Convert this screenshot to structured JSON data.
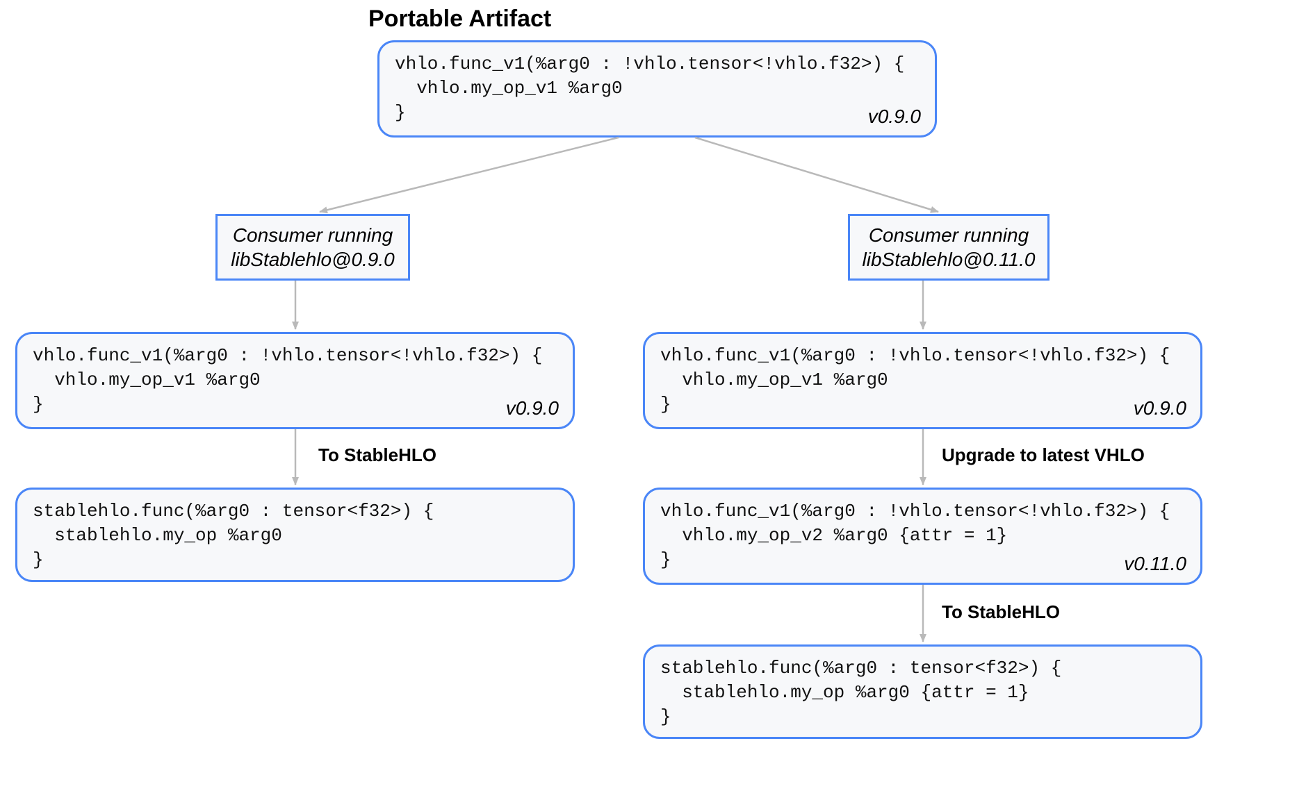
{
  "title": "Portable Artifact",
  "artifact": {
    "code": "vhlo.func_v1(%arg0 : !vhlo.tensor<!vhlo.f32>) {\n  vhlo.my_op_v1 %arg0\n}",
    "version": "v0.9.0"
  },
  "left": {
    "consumer": "Consumer running\nlibStablehlo@0.9.0",
    "step1": {
      "code": "vhlo.func_v1(%arg0 : !vhlo.tensor<!vhlo.f32>) {\n  vhlo.my_op_v1 %arg0\n}",
      "version": "v0.9.0"
    },
    "edge1": "To StableHLO",
    "step2": {
      "code": "stablehlo.func(%arg0 : tensor<f32>) {\n  stablehlo.my_op %arg0\n}"
    }
  },
  "right": {
    "consumer": "Consumer running\nlibStablehlo@0.11.0",
    "step1": {
      "code": "vhlo.func_v1(%arg0 : !vhlo.tensor<!vhlo.f32>) {\n  vhlo.my_op_v1 %arg0\n}",
      "version": "v0.9.0"
    },
    "edge1": "Upgrade to latest VHLO",
    "step2": {
      "code": "vhlo.func_v1(%arg0 : !vhlo.tensor<!vhlo.f32>) {\n  vhlo.my_op_v2 %arg0 {attr = 1}\n}",
      "version": "v0.11.0"
    },
    "edge2": "To StableHLO",
    "step3": {
      "code": "stablehlo.func(%arg0 : tensor<f32>) {\n  stablehlo.my_op %arg0 {attr = 1}\n}"
    }
  }
}
